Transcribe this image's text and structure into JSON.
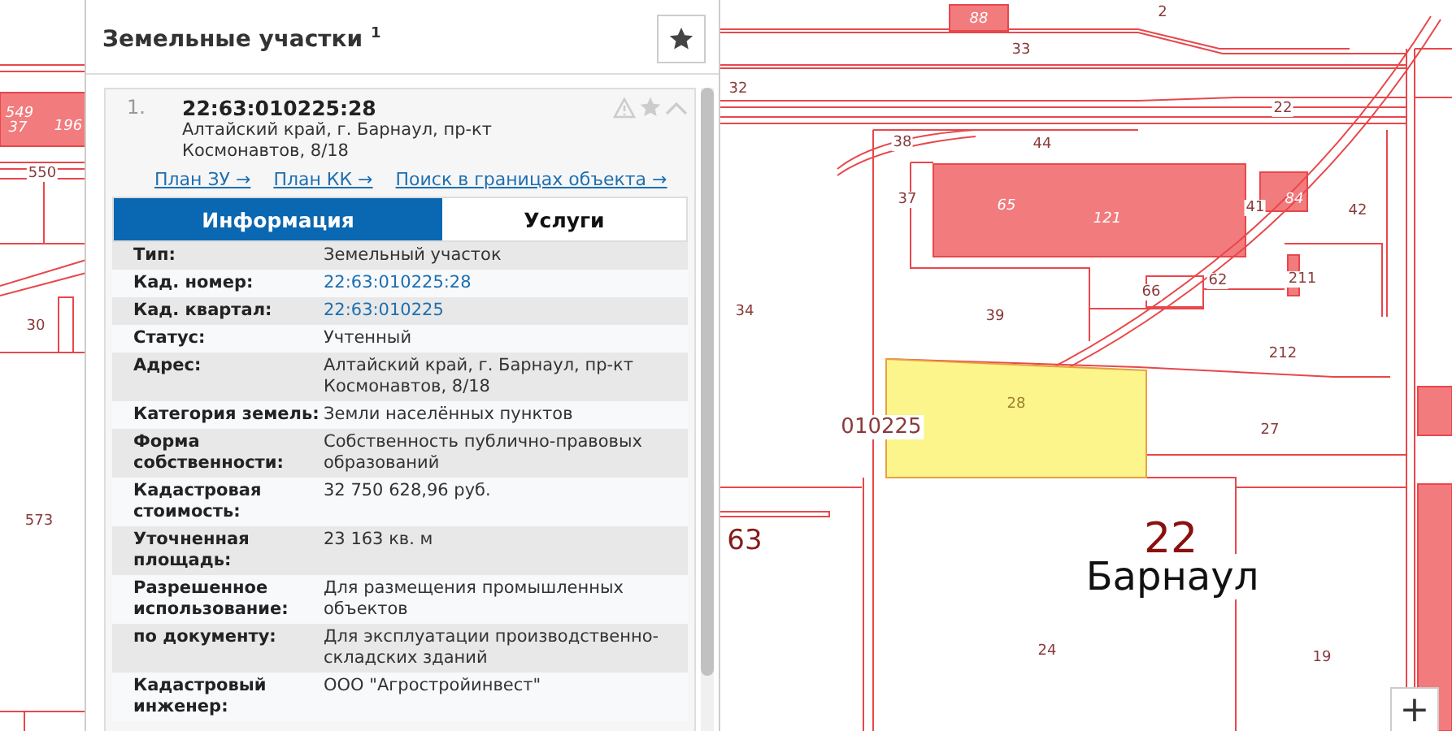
{
  "map": {
    "labels": [
      {
        "text": "549",
        "kind": "building",
        "selected": false
      },
      {
        "text": "37",
        "kind": "building",
        "selected": false
      },
      {
        "text": "196",
        "kind": "building",
        "selected": false
      },
      {
        "text": "550",
        "kind": "parcel",
        "selected": false
      },
      {
        "text": "30",
        "kind": "parcel",
        "selected": false
      },
      {
        "text": "573",
        "kind": "parcel",
        "selected": false
      },
      {
        "text": "88",
        "kind": "building",
        "selected": false
      },
      {
        "text": "2",
        "kind": "parcel",
        "selected": false
      },
      {
        "text": "33",
        "kind": "parcel",
        "selected": false
      },
      {
        "text": "32",
        "kind": "parcel",
        "selected": false
      },
      {
        "text": "22",
        "kind": "parcel",
        "selected": false
      },
      {
        "text": "38",
        "kind": "parcel",
        "selected": false
      },
      {
        "text": "44",
        "kind": "parcel",
        "selected": false
      },
      {
        "text": "37",
        "kind": "parcel",
        "selected": false
      },
      {
        "text": "65",
        "kind": "building",
        "selected": false
      },
      {
        "text": "121",
        "kind": "building",
        "selected": false
      },
      {
        "text": "41",
        "kind": "parcel",
        "selected": false
      },
      {
        "text": "84",
        "kind": "building",
        "selected": false
      },
      {
        "text": "42",
        "kind": "parcel",
        "selected": false
      },
      {
        "text": "211",
        "kind": "parcel",
        "selected": false
      },
      {
        "text": "62",
        "kind": "parcel",
        "selected": false
      },
      {
        "text": "66",
        "kind": "parcel",
        "selected": false
      },
      {
        "text": "39",
        "kind": "parcel",
        "selected": false
      },
      {
        "text": "34",
        "kind": "parcel",
        "selected": false
      },
      {
        "text": "212",
        "kind": "parcel",
        "selected": false
      },
      {
        "text": "28",
        "kind": "parcel",
        "selected": true
      },
      {
        "text": "010225",
        "kind": "quarter",
        "selected": false
      },
      {
        "text": "27",
        "kind": "parcel",
        "selected": false
      },
      {
        "text": "63",
        "kind": "district",
        "selected": false
      },
      {
        "text": "22",
        "kind": "region",
        "selected": false
      },
      {
        "text": "Барнаул",
        "kind": "city",
        "selected": false
      },
      {
        "text": "24",
        "kind": "parcel",
        "selected": false
      },
      {
        "text": "19",
        "kind": "parcel",
        "selected": false
      }
    ],
    "zoom_in": "+"
  },
  "panel": {
    "title": "Земельные участки $^{1}$",
    "result": {
      "index": "1.",
      "number": "22:63:010225:28",
      "address": "Алтайский край, г. Барнаул, пр-кт Космонавтов, 8/18",
      "links": [
        "План ЗУ →",
        "План КК →",
        "Поиск в границах объекта →"
      ],
      "tabs": [
        {
          "label": "Информация",
          "selected": true
        },
        {
          "label": "Услуги",
          "selected": false
        }
      ],
      "rows": [
        {
          "label": "Тип:",
          "value": "Земельный участок",
          "kind": "text"
        },
        {
          "label": "Кад. номер:",
          "value": "22:63:010225:28",
          "kind": "link"
        },
        {
          "label": "Кад. квартал:",
          "value": "22:63:010225",
          "kind": "link"
        },
        {
          "label": "Статус:",
          "value": "Учтенный",
          "kind": "text"
        },
        {
          "label": "Адрес:",
          "value": "Алтайский край, г. Барнаул, пр-кт Космонавтов, 8/18",
          "kind": "text"
        },
        {
          "label": "Категория земель:",
          "value": "Земли населённых пунктов",
          "kind": "text"
        },
        {
          "label": "Форма собственности:",
          "value": "Собственность публично-правовых образований",
          "kind": "text"
        },
        {
          "label": "Кадастровая стоимость:",
          "value": "32 750 628,96 руб.",
          "kind": "text"
        },
        {
          "label": "Уточненная площадь:",
          "value": "23 163 кв. м",
          "kind": "text"
        },
        {
          "label": "Разрешенное использование:",
          "value": "Для размещения промышленных объектов",
          "kind": "text"
        },
        {
          "label": "по документу:",
          "value": "Для эксплуатации производственно-складских зданий",
          "kind": "text"
        },
        {
          "label": "Кадастровый инженер:",
          "value": "ООО \"Агростройинвест\"",
          "kind": "text"
        }
      ]
    }
  }
}
